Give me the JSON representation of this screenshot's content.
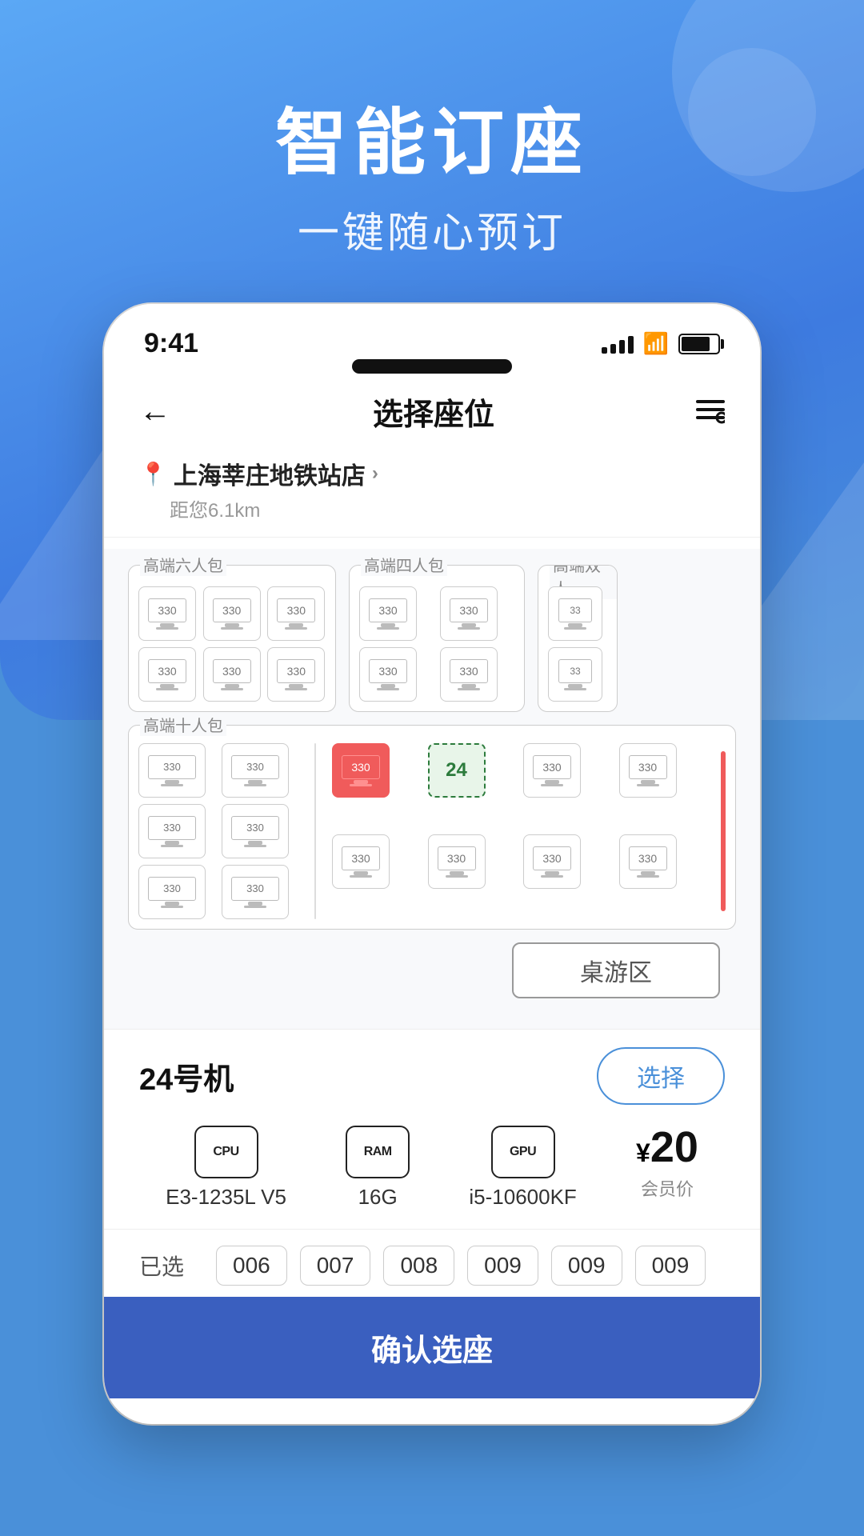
{
  "background": {
    "color": "#4A90D9"
  },
  "hero": {
    "title": "智能订座",
    "subtitle": "一键随心预订"
  },
  "statusBar": {
    "time": "9:41",
    "signalBars": 4,
    "showWifi": true,
    "showBattery": true
  },
  "navBar": {
    "backLabel": "←",
    "title": "选择座位",
    "searchIcon": "☰🔍"
  },
  "location": {
    "pinIcon": "📍",
    "name": "上海莘庄地铁站店",
    "chevron": "›",
    "distance": "距您6.1km"
  },
  "rooms": [
    {
      "label": "高端六人包",
      "seats": [
        {
          "num": "330",
          "state": "normal"
        },
        {
          "num": "330",
          "state": "normal"
        },
        {
          "num": "330",
          "state": "normal"
        },
        {
          "num": "330",
          "state": "normal"
        },
        {
          "num": "330",
          "state": "normal"
        },
        {
          "num": "330",
          "state": "normal"
        }
      ]
    },
    {
      "label": "高端四人包",
      "seats": [
        {
          "num": "330",
          "state": "normal"
        },
        {
          "num": "330",
          "state": "normal"
        },
        {
          "num": "330",
          "state": "normal"
        },
        {
          "num": "330",
          "state": "normal"
        }
      ]
    },
    {
      "label": "高端双人",
      "seats": [
        {
          "num": "33",
          "state": "normal"
        },
        {
          "num": "33",
          "state": "normal"
        }
      ]
    }
  ],
  "room10": {
    "label": "高端十人包",
    "leftSeats": [
      {
        "num": "330",
        "state": "normal"
      },
      {
        "num": "330",
        "state": "normal"
      },
      {
        "num": "330",
        "state": "normal"
      },
      {
        "num": "330",
        "state": "normal"
      },
      {
        "num": "330",
        "state": "normal"
      },
      {
        "num": "330",
        "state": "normal"
      }
    ],
    "rightSeats": [
      {
        "num": "330",
        "state": "occupied"
      },
      {
        "num": "24",
        "state": "selected"
      },
      {
        "num": "330",
        "state": "normal"
      },
      {
        "num": "330",
        "state": "normal"
      },
      {
        "num": "330",
        "state": "normal"
      },
      {
        "num": "330",
        "state": "normal"
      },
      {
        "num": "330",
        "state": "normal"
      },
      {
        "num": "330",
        "state": "normal"
      }
    ]
  },
  "tableGameZone": "桌游区",
  "machineInfo": {
    "name": "24号机",
    "selectLabel": "选择",
    "specs": {
      "cpu": {
        "iconLabel": "CPU",
        "value": "E3-1235L V5"
      },
      "ram": {
        "iconLabel": "RAM",
        "value": "16G"
      },
      "gpu": {
        "iconLabel": "GPU",
        "value": "i5-10600KF"
      },
      "price": {
        "currency": "¥",
        "amount": "20",
        "label": "会员价"
      }
    }
  },
  "selectedSeats": {
    "label": "已选",
    "seats": [
      "006",
      "007",
      "008",
      "009",
      "009",
      "009"
    ]
  },
  "confirmButton": {
    "label": "确认选座"
  }
}
